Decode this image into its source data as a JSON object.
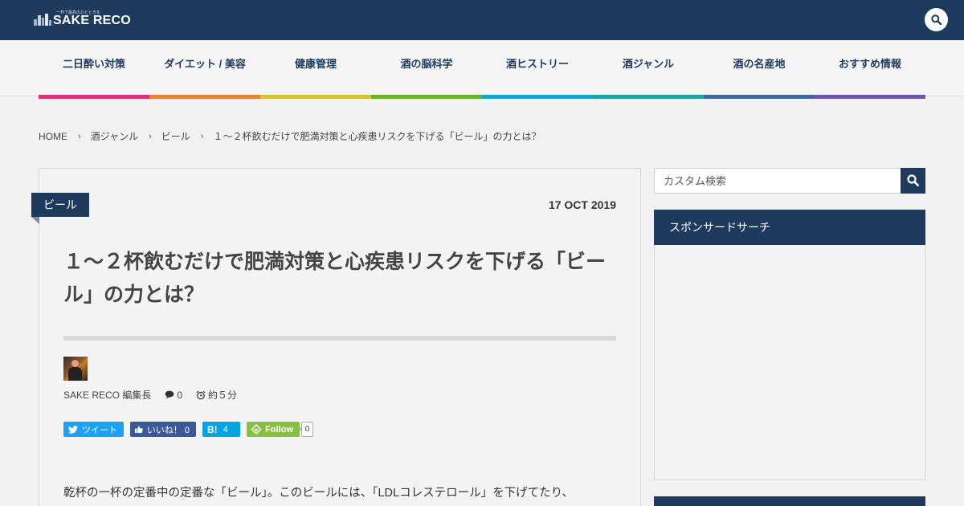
{
  "header": {
    "logo_tagline": "一杯で最高のひとときを",
    "logo_text": "SAKE RECO"
  },
  "nav": {
    "items": [
      {
        "label": "二日酔い対策",
        "color": "#d9317a"
      },
      {
        "label": "ダイエット / 美容",
        "color": "#e8803c"
      },
      {
        "label": "健康管理",
        "color": "#d4c234"
      },
      {
        "label": "酒の脳科学",
        "color": "#6bb033"
      },
      {
        "label": "酒ヒストリー",
        "color": "#17a6c9"
      },
      {
        "label": "酒ジャンル",
        "color": "#1fa3a3"
      },
      {
        "label": "酒の名産地",
        "color": "#3d6a9a"
      },
      {
        "label": "おすすめ情報",
        "color": "#6a5aa8"
      }
    ]
  },
  "breadcrumb": {
    "items": [
      "HOME",
      "酒ジャンル",
      "ビール"
    ],
    "current": "１〜２杯飲むだけで肥満対策と心疾患リスクを下げる「ビール」の力とは？",
    "separator": "›"
  },
  "article": {
    "category": "ビール",
    "date": "17 OCT 2019",
    "title": "１〜２杯飲むだけで肥満対策と心疾患リスクを下げる「ビール」の力とは？",
    "author": "SAKE RECO 編集長",
    "comments": "0",
    "read_time": "約５分",
    "share": {
      "tweet": "ツイート",
      "like": "いいね！ 0",
      "hatena_count": "4",
      "follow": "Follow",
      "follow_count": "0"
    },
    "intro": "乾杯の一杯の定番中の定番な「ビール」。このビールには、「LDLコレステロール」を下げてたり、"
  },
  "sidebar": {
    "search_placeholder": "カスタム検索",
    "sponsor_title": "スポンサードサーチ"
  },
  "colors": {
    "brand": "#1e3a5c",
    "twitter": "#1da1f2",
    "facebook": "#3b5998",
    "hatena": "#00a4de",
    "feedly": "#87c040"
  },
  "icons": {
    "search": "search-icon",
    "comment": "comment-icon",
    "clock": "alarm-clock-icon",
    "twitter": "twitter-icon",
    "like": "thumbs-up-icon",
    "hatena": "hatena-bookmark-icon",
    "feedly": "feedly-icon"
  }
}
